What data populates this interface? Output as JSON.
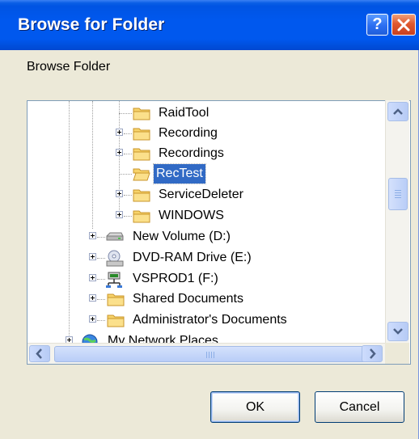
{
  "window": {
    "title": "Browse for Folder",
    "help_label": "?"
  },
  "prompt": "Browse Folder",
  "tree": {
    "items": [
      {
        "label": "RaidTool",
        "icon": "folder-icon",
        "expander": false,
        "selected": false
      },
      {
        "label": "Recording",
        "icon": "folder-icon",
        "expander": true,
        "selected": false
      },
      {
        "label": "Recordings",
        "icon": "folder-icon",
        "expander": true,
        "selected": false
      },
      {
        "label": "RecTest",
        "icon": "folder-open-icon",
        "expander": false,
        "selected": true
      },
      {
        "label": "ServiceDeleter",
        "icon": "folder-icon",
        "expander": true,
        "selected": false
      },
      {
        "label": "WINDOWS",
        "icon": "folder-icon",
        "expander": true,
        "selected": false
      },
      {
        "label": "New Volume (D:)",
        "icon": "hard-drive-icon",
        "expander": true,
        "selected": false
      },
      {
        "label": "DVD-RAM Drive (E:)",
        "icon": "dvd-drive-icon",
        "expander": true,
        "selected": false
      },
      {
        "label": "VSPROD1 (F:)",
        "icon": "network-drive-icon",
        "expander": true,
        "selected": false
      },
      {
        "label": "Shared Documents",
        "icon": "folder-icon",
        "expander": true,
        "selected": false
      },
      {
        "label": "Administrator's Documents",
        "icon": "folder-icon",
        "expander": true,
        "selected": false
      },
      {
        "label": "My Network Places",
        "icon": "network-places-icon",
        "expander": true,
        "selected": false
      }
    ]
  },
  "buttons": {
    "ok": "OK",
    "cancel": "Cancel"
  },
  "colors": {
    "titlebar": "#0058ee",
    "selection": "#316ac5",
    "dialog_bg": "#ece9d8"
  }
}
